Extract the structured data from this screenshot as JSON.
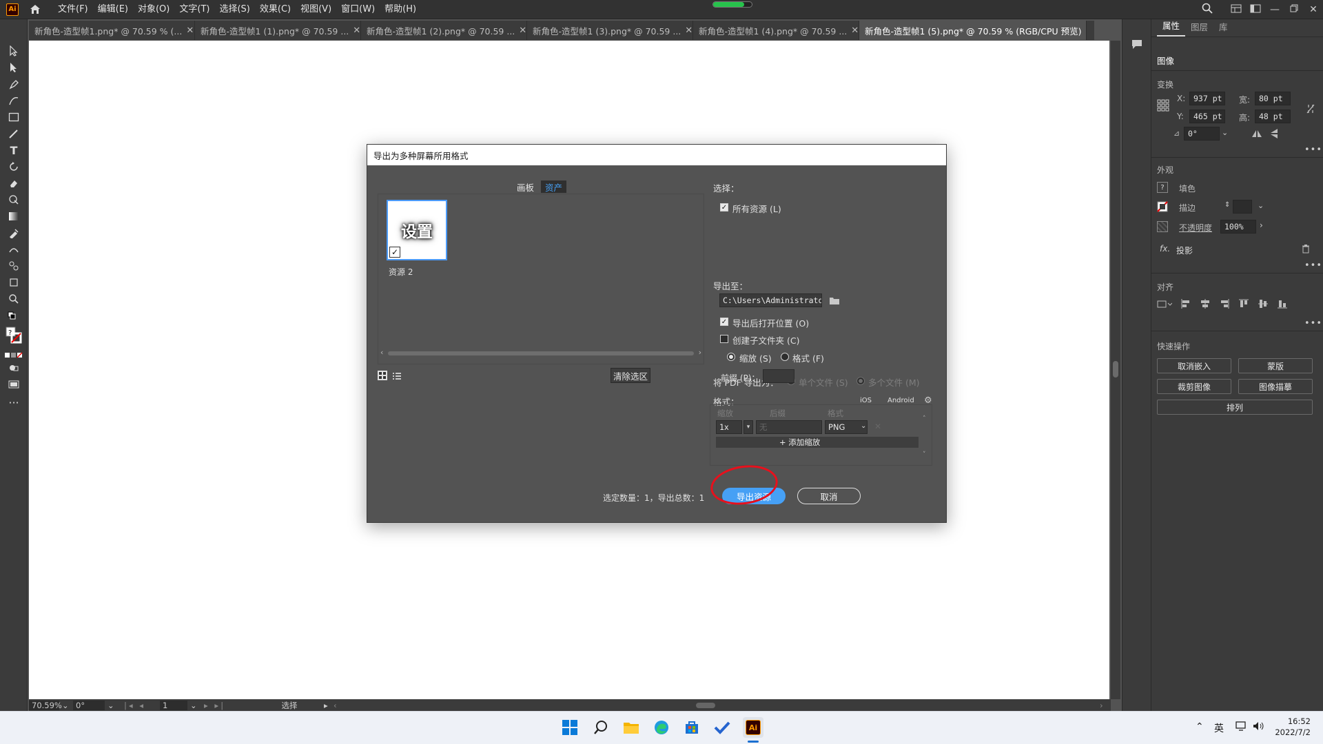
{
  "app": {
    "logo": "Ai",
    "menu": [
      "文件(F)",
      "编辑(E)",
      "对象(O)",
      "文字(T)",
      "选择(S)",
      "效果(C)",
      "视图(V)",
      "窗口(W)",
      "帮助(H)"
    ]
  },
  "tabs": [
    {
      "label": "新角色-造型帧1.png* @ 70.59 % (...",
      "active": false
    },
    {
      "label": "新角色-造型帧1 (1).png* @ 70.59 ...",
      "active": false
    },
    {
      "label": "新角色-造型帧1 (2).png* @ 70.59 ...",
      "active": false
    },
    {
      "label": "新角色-造型帧1 (3).png* @ 70.59 ...",
      "active": false
    },
    {
      "label": "新角色-造型帧1 (4).png* @ 70.59 ...",
      "active": false
    },
    {
      "label": "新角色-造型帧1 (5).png* @ 70.59 % (RGB/CPU 预览)",
      "active": true
    }
  ],
  "status": {
    "zoom": "70.59%",
    "rotate": "0°",
    "artboard": "1",
    "tool": "选择"
  },
  "properties": {
    "tabs": [
      "属性",
      "图层",
      "库"
    ],
    "section_image": "图像",
    "transform_title": "变换",
    "x_label": "X:",
    "x": "937 pt",
    "y_label": "Y:",
    "y": "465 pt",
    "w_label": "宽:",
    "w": "80 pt",
    "h_label": "高:",
    "h": "48 pt",
    "angle": "0°",
    "appearance_title": "外观",
    "fill_label": "填色",
    "stroke_label": "描边",
    "opacity_label": "不透明度",
    "opacity": "100%",
    "fx_label": "投影",
    "align_title": "对齐",
    "quick_title": "快速操作",
    "btn_unembed": "取消嵌入",
    "btn_mask": "蒙版",
    "btn_crop": "裁剪图像",
    "btn_trace": "图像描摹",
    "btn_arrange": "排列"
  },
  "dialog": {
    "title": "导出为多种屏幕所用格式",
    "tab_artboard": "画板",
    "tab_assets": "资产",
    "asset_thumb_text": "设置",
    "asset_name": "资源 2",
    "select_label": "选择：",
    "all_assets": "所有资源 (L)",
    "export_to": "导出至：",
    "path": "C:\\Users\\Administrator\\D",
    "open_after": "导出后打开位置 (O)",
    "create_subfolder": "创建子文件夹 (C)",
    "radio_scale": "缩放 (S)",
    "radio_format": "格式 (F)",
    "pdf_export_as": "将 PDF 导出为：",
    "single_file": "单个文件 (S)",
    "multi_file": "多个文件 (M)",
    "format_label": "格式：",
    "ios": "iOS",
    "android": "Android",
    "col_scale": "缩放",
    "col_suffix": "后缀",
    "col_format": "格式",
    "scale_value": "1x",
    "suffix_placeholder": "无",
    "format_value": "PNG",
    "add_scale": "+ 添加缩放",
    "clear_selection": "清除选区",
    "prefix_label": "前缀 (P)：",
    "summary": "选定数量：1，导出总数：1",
    "export_button": "导出资源",
    "cancel_button": "取消"
  },
  "taskbar": {
    "time": "16:52",
    "date": "2022/7/2",
    "ime": "英"
  },
  "colors": {
    "accent": "#46a0f5",
    "annotation": "#e8101c"
  }
}
